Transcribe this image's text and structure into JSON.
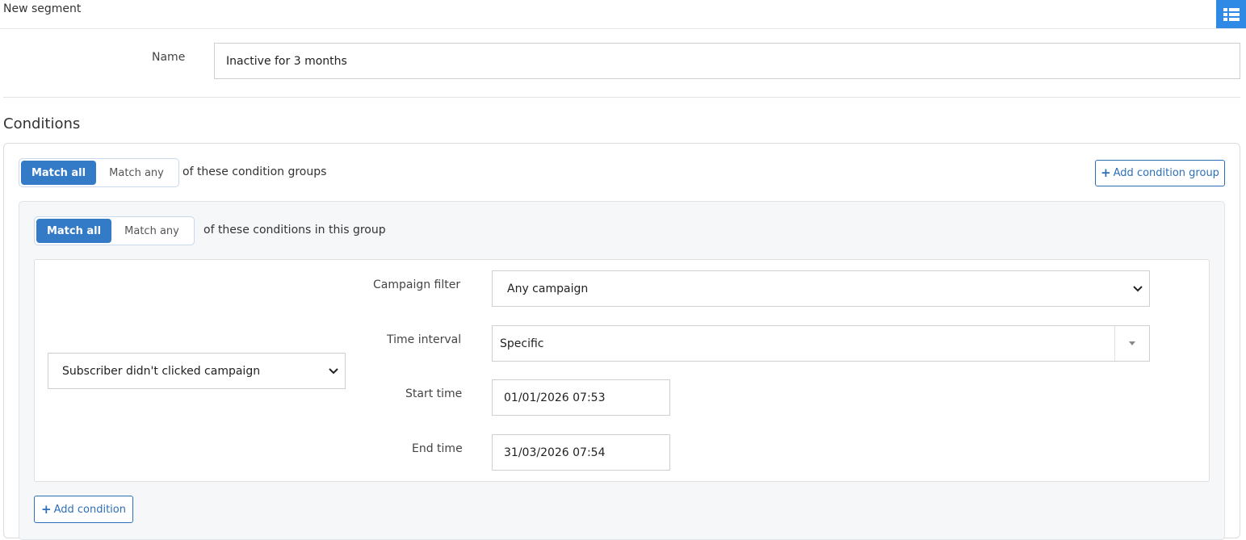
{
  "header": {
    "title": "New segment",
    "menu_icon": "list-icon",
    "accent_color": "#2f8ae6"
  },
  "form": {
    "name_label": "Name",
    "name_value": "Inactive for 3 months"
  },
  "conditions": {
    "section_title": "Conditions",
    "outer_toggle": {
      "match_all": "Match all",
      "match_any": "Match any",
      "selected": "Match all"
    },
    "outer_suffix": "of these condition groups",
    "add_group_label": "Add condition group",
    "group": {
      "toggle": {
        "match_all": "Match all",
        "match_any": "Match any",
        "selected": "Match all"
      },
      "suffix": "of these conditions in this group",
      "condition": {
        "type_value": "Subscriber didn't clicked campaign",
        "campaign_filter_label": "Campaign filter",
        "campaign_filter_value": "Any campaign",
        "time_interval_label": "Time interval",
        "time_interval_value": "Specific",
        "start_time_label": "Start time",
        "start_time_value": "01/01/2026 07:53",
        "end_time_label": "End time",
        "end_time_value": "31/03/2026 07:54"
      },
      "add_condition_label": "Add condition"
    }
  }
}
